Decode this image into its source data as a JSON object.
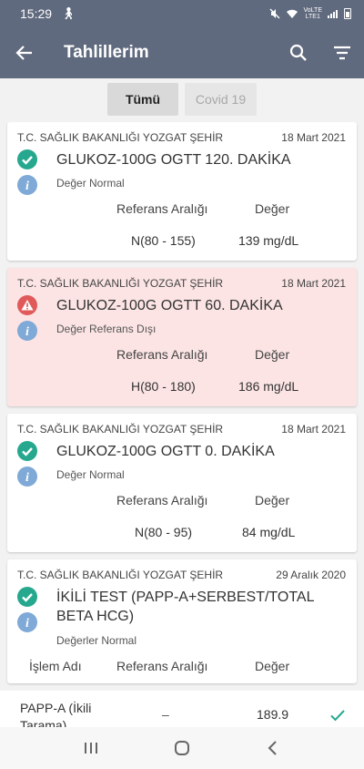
{
  "status_bar": {
    "time": "15:29",
    "network": "VoLTE",
    "lte": "LTE1"
  },
  "app_bar": {
    "title": "Tahlillerim"
  },
  "filters": [
    {
      "label": "Tümü",
      "selected": true
    },
    {
      "label": "Covid 19",
      "selected": false
    }
  ],
  "cards": [
    {
      "institution": "T.C. SAĞLIK BAKANLIĞI YOZGAT ŞEHİR",
      "date": "18 Mart 2021",
      "test_name": "GLUKOZ-100G OGTT 120. DAKİKA",
      "status_text": "Değer Normal",
      "status": "normal",
      "ref_header": "Referans Aralığı",
      "val_header": "Değer",
      "ref_value": "N(80 - 155)",
      "value": "139 mg/dL"
    },
    {
      "institution": "T.C. SAĞLIK BAKANLIĞI YOZGAT ŞEHİR",
      "date": "18 Mart 2021",
      "test_name": "GLUKOZ-100G OGTT 60. DAKİKA",
      "status_text": "Değer Referans Dışı",
      "status": "alert",
      "ref_header": "Referans Aralığı",
      "val_header": "Değer",
      "ref_value": "H(80 - 180)",
      "value": "186 mg/dL"
    },
    {
      "institution": "T.C. SAĞLIK BAKANLIĞI YOZGAT ŞEHİR",
      "date": "18 Mart 2021",
      "test_name": "GLUKOZ-100G OGTT 0. DAKİKA",
      "status_text": "Değer Normal",
      "status": "normal",
      "ref_header": "Referans Aralığı",
      "val_header": "Değer",
      "ref_value": "N(80 - 95)",
      "value": "84 mg/dL"
    },
    {
      "institution": "T.C. SAĞLIK BAKANLIĞI YOZGAT ŞEHİR",
      "date": "29 Aralık 2020",
      "test_name": "İKİLİ TEST (PAPP-A+SERBEST/TOTAL BETA HCG)",
      "status_text": "Değerler Normal",
      "status": "normal",
      "name_header": "İşlem Adı",
      "ref_header": "Referans Aralığı",
      "val_header": "Değer",
      "sub_rows": [
        {
          "name": "PAPP-A (İkili Tarama)",
          "range": "–",
          "value": "189.9"
        }
      ]
    }
  ],
  "colors": {
    "app_bar": "#606a7e",
    "ok": "#26a88e",
    "alert": "#e05a5a",
    "info": "#7fa9d6",
    "alert_bg": "#fce4e4"
  }
}
